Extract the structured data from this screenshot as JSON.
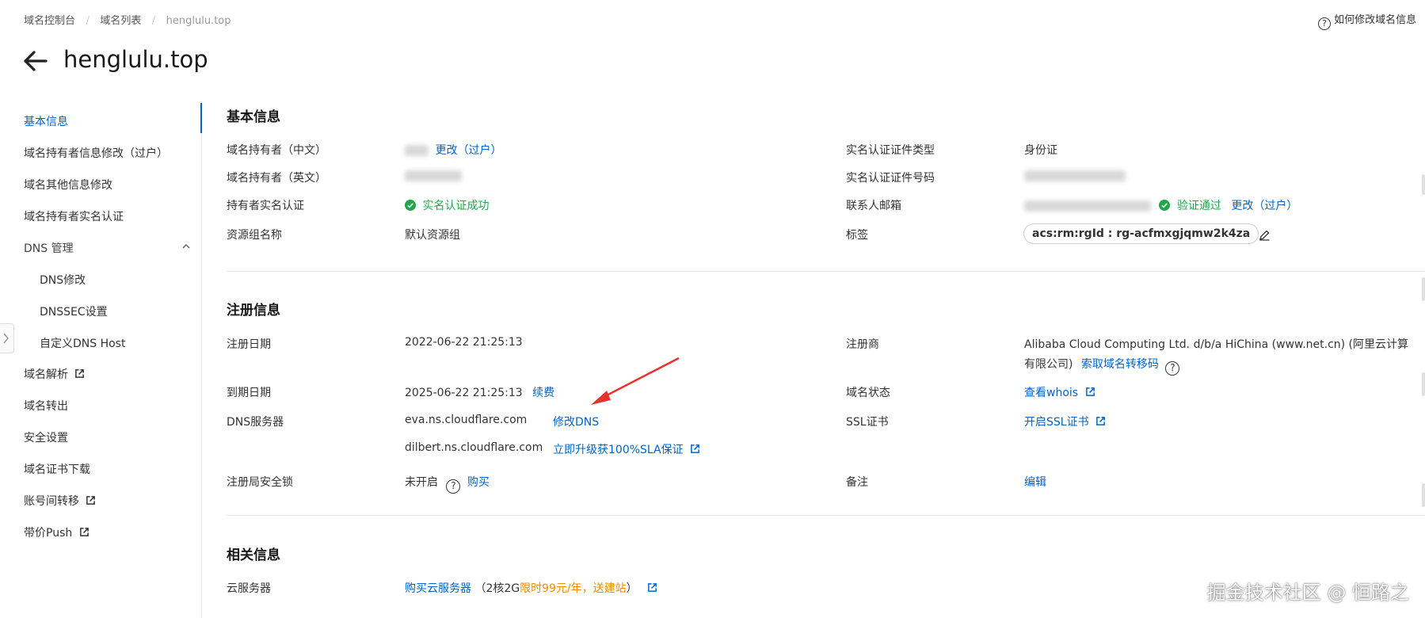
{
  "breadcrumb": {
    "items": [
      "域名控制台",
      "域名列表",
      "henglulu.top"
    ],
    "help_text": "如何修改域名信息"
  },
  "header": {
    "title": "henglulu.top"
  },
  "sidebar": {
    "items": [
      {
        "label": "基本信息"
      },
      {
        "label": "域名持有者信息修改（过户）"
      },
      {
        "label": "域名其他信息修改"
      },
      {
        "label": "域名持有者实名认证"
      },
      {
        "label": "DNS 管理"
      },
      {
        "label": "DNS修改"
      },
      {
        "label": "DNSSEC设置"
      },
      {
        "label": "自定义DNS Host"
      },
      {
        "label": "域名解析"
      },
      {
        "label": "域名转出"
      },
      {
        "label": "安全设置"
      },
      {
        "label": "域名证书下载"
      },
      {
        "label": "账号间转移"
      },
      {
        "label": "带价Push"
      }
    ]
  },
  "basic": {
    "title": "基本信息",
    "holder_cn_label": "域名持有者（中文）",
    "holder_cn_action": "更改（过户）",
    "holder_en_label": "域名持有者（英文）",
    "realname_label": "持有者实名认证",
    "realname_status": "实名认证成功",
    "resource_group_label": "资源组名称",
    "resource_group_value": "默认资源组",
    "cert_type_label": "实名认证证件类型",
    "cert_type_value": "身份证",
    "cert_no_label": "实名认证证件号码",
    "email_label": "联系人邮箱",
    "email_status": "验证通过",
    "email_action": "更改（过户）",
    "tag_label": "标签",
    "tag_value": "acs:rm:rgId : rg-acfmxgjqmw2k4za"
  },
  "registration": {
    "title": "注册信息",
    "reg_date_label": "注册日期",
    "reg_date_value": "2022-06-22 21:25:13",
    "expire_label": "到期日期",
    "expire_value": "2025-06-22 21:25:13",
    "renew_action": "续费",
    "dns_label": "DNS服务器",
    "dns1": "eva.ns.cloudflare.com",
    "dns_modify_action": "修改DNS",
    "dns2": "dilbert.ns.cloudflare.com",
    "upgrade_action": "立即升级获100%SLA保证",
    "lock_label": "注册局安全锁",
    "lock_value": "未开启",
    "buy_action": "购买",
    "registrar_label": "注册商",
    "registrar_value_1": "Alibaba Cloud Computing Ltd. d/b/a HiChina (www.net.cn) (阿里云计算",
    "registrar_value_2": "有限公司)",
    "transfer_code_action": "索取域名转移码",
    "status_label": "域名状态",
    "whois_action": "查看whois",
    "ssl_label": "SSL证书",
    "ssl_action": "开启SSL证书",
    "remark_label": "备注",
    "edit_action": "编辑"
  },
  "related": {
    "title": "相关信息",
    "server_label": "云服务器",
    "buy_server_action": "购买云服务器",
    "promo_prefix": "（2核2G",
    "promo_highlight": "限时99元/年，送建站",
    "promo_suffix": "）"
  },
  "watermark": "掘金技术社区 @ 恒路之",
  "colors": {
    "link": "#0064c8",
    "success": "#1ea84a",
    "promo": "#f08c00",
    "arrow": "#e8302d"
  }
}
